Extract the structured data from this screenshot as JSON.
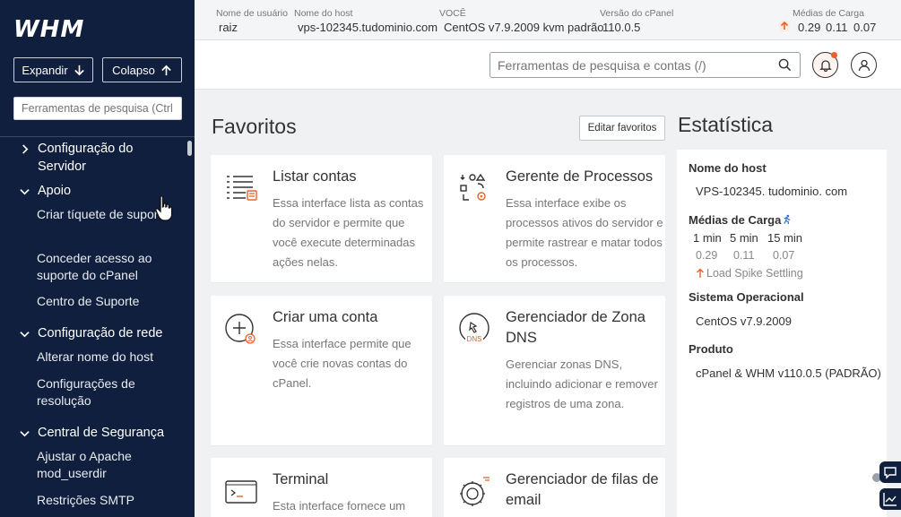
{
  "logo": "WHM",
  "sidebar": {
    "expand_label": "Expandir",
    "collapse_label": "Colapso",
    "search_placeholder": "Ferramentas de pesquisa (Ctrl",
    "categories": [
      {
        "label": "Configuração do Servidor",
        "expanded": false
      },
      {
        "label": "Apoio",
        "expanded": true,
        "items": [
          "Criar tíquete de suporte",
          "Conceder acesso ao suporte do cPanel",
          "Centro de Suporte"
        ]
      },
      {
        "label": "Configuração de rede",
        "expanded": true,
        "items": [
          "Alterar nome do host",
          "Configurações de resolução"
        ]
      },
      {
        "label": "Central de Segurança",
        "expanded": true,
        "items": [
          "Ajustar o Apache mod_userdir",
          "Restrições SMTP"
        ]
      }
    ]
  },
  "infobar": {
    "username_label": "Nome de usuário",
    "username": "raiz",
    "hostname_label": "Nome do host",
    "hostname": "vps-102345.tudominio.com",
    "os_label": "VOCÊ",
    "os": "CentOS v7.9.2009 kvm padrão",
    "version_label": "Versão do cPanel",
    "version": "110.0.5",
    "load_label": "Médias de Carga",
    "load_values": [
      "0.29",
      "0.11",
      "0.07"
    ]
  },
  "header": {
    "search_placeholder": "Ferramentas de pesquisa e contas (/)"
  },
  "favorites": {
    "title": "Favoritos",
    "edit_label": "Editar favoritos",
    "cards": [
      {
        "icon": "list-accounts-icon",
        "title": "Listar contas",
        "desc": "Essa interface lista as contas do servidor e permite que você execute determinadas ações nelas."
      },
      {
        "icon": "process-manager-icon",
        "title": "Gerente de Processos",
        "desc": "Essa interface exibe os processos ativos do servidor e permite rastrear e matar todos os processos."
      },
      {
        "icon": "create-account-icon",
        "title": "Criar uma conta",
        "desc": "Essa interface permite que você crie novas contas do cPanel."
      },
      {
        "icon": "dns-icon",
        "title": "Gerenciador de Zona DNS",
        "desc": "Gerenciar zonas DNS, incluindo adicionar e remover registros de uma zona."
      },
      {
        "icon": "terminal-icon",
        "title": "Terminal",
        "desc": "Esta interface fornece um"
      },
      {
        "icon": "mail-queue-icon",
        "title": "Gerenciador de filas de email",
        "desc": ""
      }
    ]
  },
  "stats": {
    "title": "Estatística",
    "hostname_label": "Nome do host",
    "hostname": "VPS-102345. tudominio. com",
    "load_label": "Médias de Carga",
    "load_headers": [
      "1 min",
      "5 min",
      "15 min"
    ],
    "load_values": [
      "0.29",
      "0.11",
      "0.07"
    ],
    "spike_text": "Load Spike Settling",
    "os_label": "Sistema Operacional",
    "os": "CentOS v7.9.2009",
    "product_label": "Produto",
    "product": "cPanel & WHM v110.0.5 (PADRÃO)"
  },
  "colors": {
    "sidebar_bg": "#0f1f3d",
    "accent_orange": "#e8622c",
    "accent_blue": "#2d6fd8"
  }
}
